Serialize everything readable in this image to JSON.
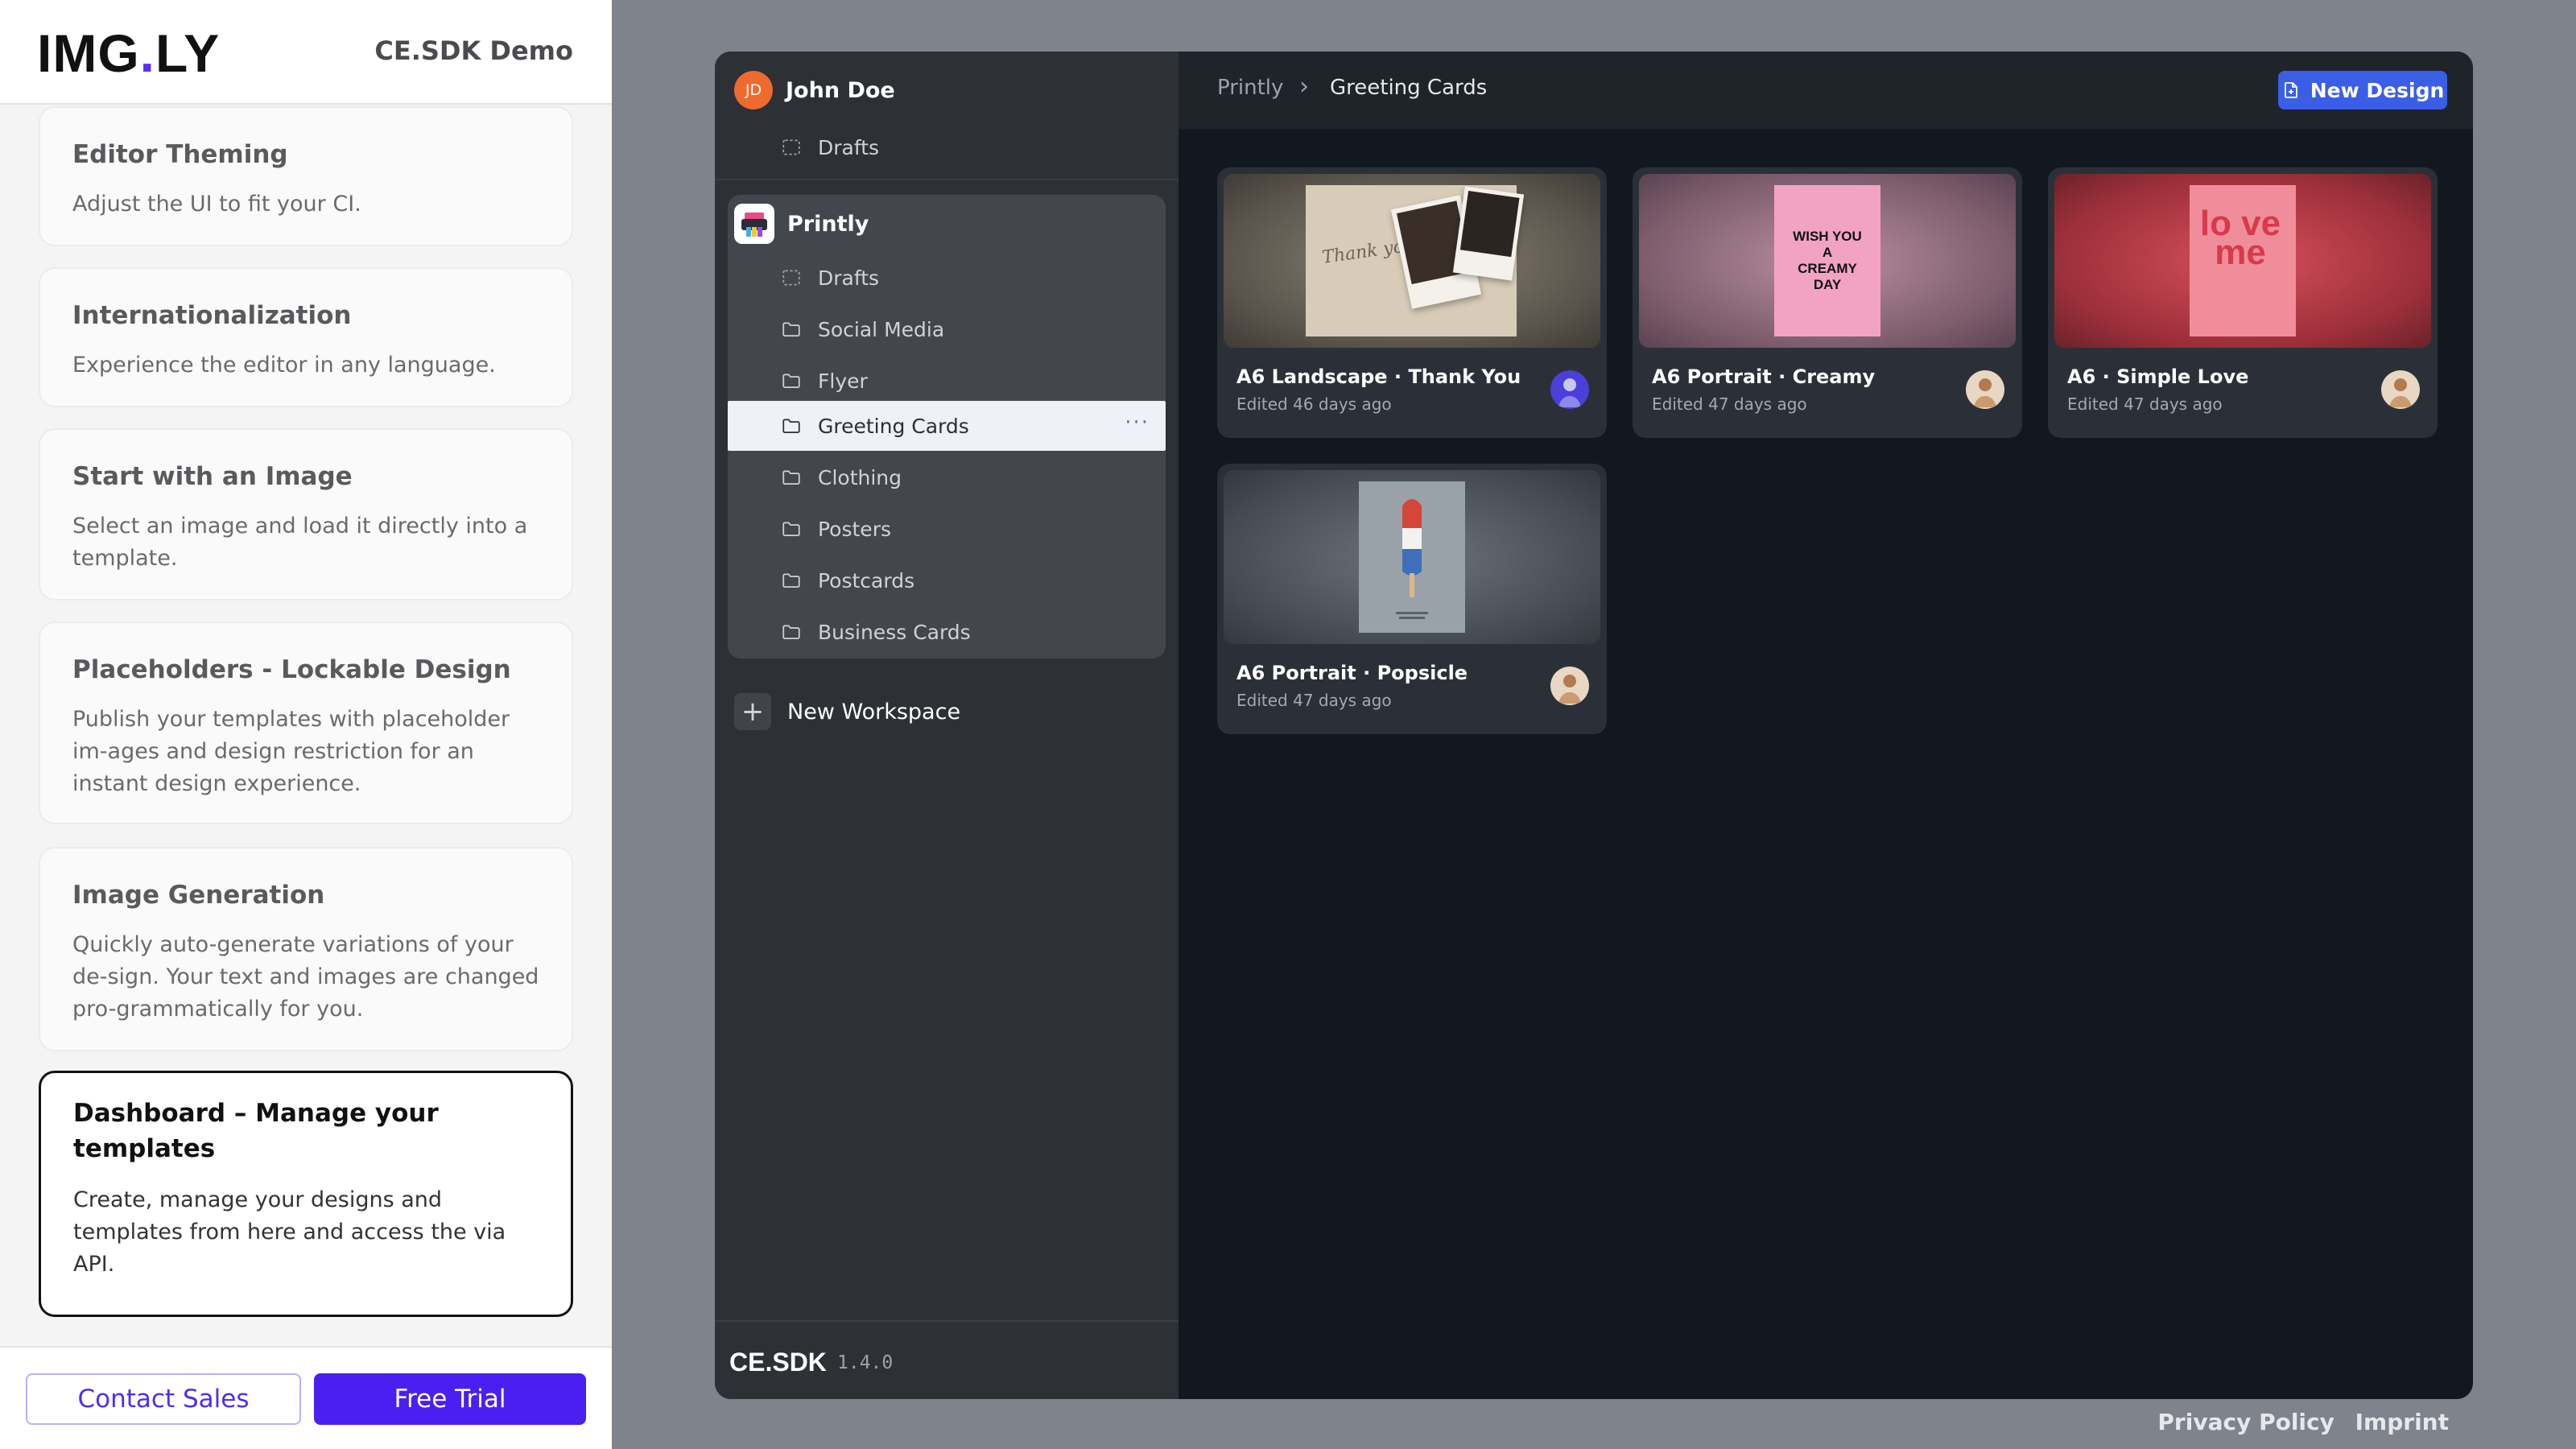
{
  "demo": {
    "logo": {
      "prefix": "IMG",
      "dot": ".",
      "suffix": "LY"
    },
    "title": "CE.SDK Demo",
    "cards": [
      {
        "title": "Editor Theming",
        "desc": "Adjust the UI to fit your CI."
      },
      {
        "title": "Internationalization",
        "desc": "Experience the editor in any language."
      },
      {
        "title": "Start with an Image",
        "desc": "Select an image and load it directly into a template."
      },
      {
        "title": "Placeholders - Lockable Design",
        "desc": "Publish your templates with placeholder im-ages and design restriction for an instant design experience."
      },
      {
        "title": "Image Generation",
        "desc": "Quickly auto-generate variations of your de-sign. Your text and images are changed pro-grammatically for you."
      },
      {
        "title": "Dashboard – Manage your templates",
        "desc": "Create, manage your designs and templates from here and access the via API."
      }
    ],
    "contact_label": "Contact Sales",
    "trial_label": "Free Trial"
  },
  "sidebar": {
    "user": {
      "initials": "JD",
      "name": "John Doe",
      "avatar_color": "#ee6a2e"
    },
    "user_items": [
      {
        "label": "Drafts",
        "icon": "drafts-icon"
      }
    ],
    "workspace": {
      "name": "Printly",
      "items": [
        {
          "label": "Drafts",
          "icon": "drafts-icon"
        },
        {
          "label": "Social Media",
          "icon": "folder-icon"
        },
        {
          "label": "Flyer",
          "icon": "folder-icon"
        },
        {
          "label": "Greeting Cards",
          "icon": "folder-icon",
          "active": true
        },
        {
          "label": "Clothing",
          "icon": "folder-icon"
        },
        {
          "label": "Posters",
          "icon": "folder-icon"
        },
        {
          "label": "Postcards",
          "icon": "folder-icon"
        },
        {
          "label": "Business Cards",
          "icon": "folder-icon"
        }
      ],
      "more": "···"
    },
    "new_workspace_label": "New Workspace",
    "brand": "CE.SDK",
    "version": "1.4.0"
  },
  "topbar": {
    "breadcrumb": [
      "Printly",
      "Greeting Cards"
    ],
    "separator": "›",
    "new_design_label": "New Design",
    "accent": "#3a5ee6"
  },
  "designs": [
    {
      "title": "A6 Landscape · Thank You",
      "meta": "Edited 46 days ago",
      "thumb_text": "Thank you"
    },
    {
      "title": "A6 Portrait · Creamy",
      "meta": "Edited 47 days ago",
      "thumb_text": "WISH YOU A CREAMY DAY"
    },
    {
      "title": "A6 · Simple Love",
      "meta": "Edited 47 days ago",
      "thumb_text": "lo ve me"
    },
    {
      "title": "A6 Portrait · Popsicle",
      "meta": "Edited 47 days ago",
      "thumb_text": ""
    }
  ],
  "footer": {
    "privacy": "Privacy Policy",
    "imprint": "Imprint"
  }
}
